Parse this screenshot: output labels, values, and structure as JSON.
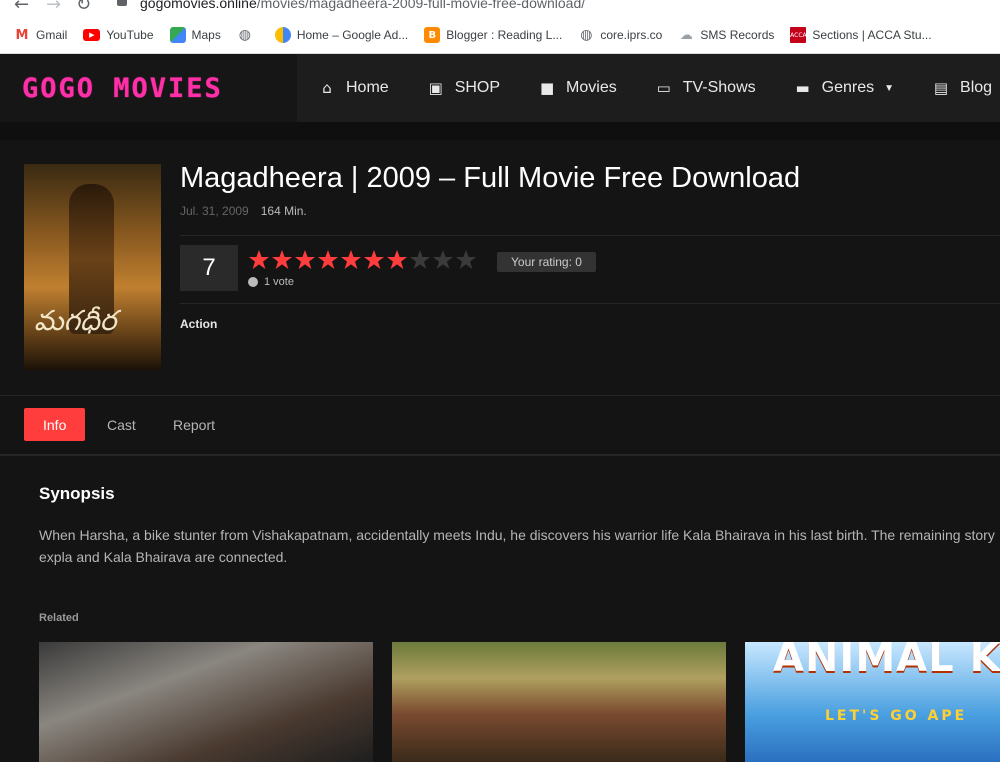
{
  "browser": {
    "url_host": "gogomovies.online",
    "url_path": "/movies/magadheera-2009-full-movie-free-download/",
    "bookmarks": [
      {
        "label": "Gmail",
        "icon": "gmail-icon",
        "color": "#ea4335"
      },
      {
        "label": "YouTube",
        "icon": "youtube-icon",
        "color": "#ff0000"
      },
      {
        "label": "Maps",
        "icon": "maps-icon",
        "color": "#34a853"
      },
      {
        "label": "",
        "icon": "globe-icon",
        "color": "#5f6368"
      },
      {
        "label": "Home – Google Ad...",
        "icon": "google-ads-icon",
        "color": "#4285f4"
      },
      {
        "label": "Blogger : Reading L...",
        "icon": "blogger-icon",
        "color": "#ff8a00"
      },
      {
        "label": "core.iprs.co",
        "icon": "globe-icon",
        "color": "#5f6368"
      },
      {
        "label": "SMS Records",
        "icon": "sms-icon",
        "color": "#9aa0a6"
      },
      {
        "label": "Sections | ACCA Stu...",
        "icon": "acca-icon",
        "color": "#c4001a"
      }
    ]
  },
  "site": {
    "logo": "GOGO MOVIES",
    "nav": [
      {
        "label": "Home",
        "icon": "home-icon"
      },
      {
        "label": "SHOP",
        "icon": "shop-icon"
      },
      {
        "label": "Movies",
        "icon": "movie-camera-icon"
      },
      {
        "label": "TV-Shows",
        "icon": "tv-icon"
      },
      {
        "label": "Genres",
        "icon": "folder-icon"
      },
      {
        "label": "Blog",
        "icon": "document-icon"
      }
    ]
  },
  "movie": {
    "title": "Magadheera | 2009 – Full Movie Free Download",
    "date": "Jul. 31, 2009",
    "duration": "164 Min.",
    "score": "7",
    "rating": {
      "filled": 7,
      "total": 10
    },
    "votes": "1 vote",
    "your_rating": "Your rating: 0",
    "genre": "Action",
    "poster_title": "మగధీర"
  },
  "tabs": [
    "Info",
    "Cast",
    "Report"
  ],
  "synopsis": {
    "heading": "Synopsis",
    "text": "When Harsha, a bike stunter from Vishakapatnam, accidentally meets Indu, he discovers his warrior life Kala Bhairava in his last birth. The remaining story expla and Kala Bhairava are connected."
  },
  "related": {
    "label": "Related",
    "card3_title": "ANIMAL KINGDOM",
    "card3_subtitle": "LET'S GO APE"
  },
  "colors": {
    "accent": "#ff3d3d",
    "logo": "#ff2fa8",
    "star_empty": "#3a3a3a"
  }
}
